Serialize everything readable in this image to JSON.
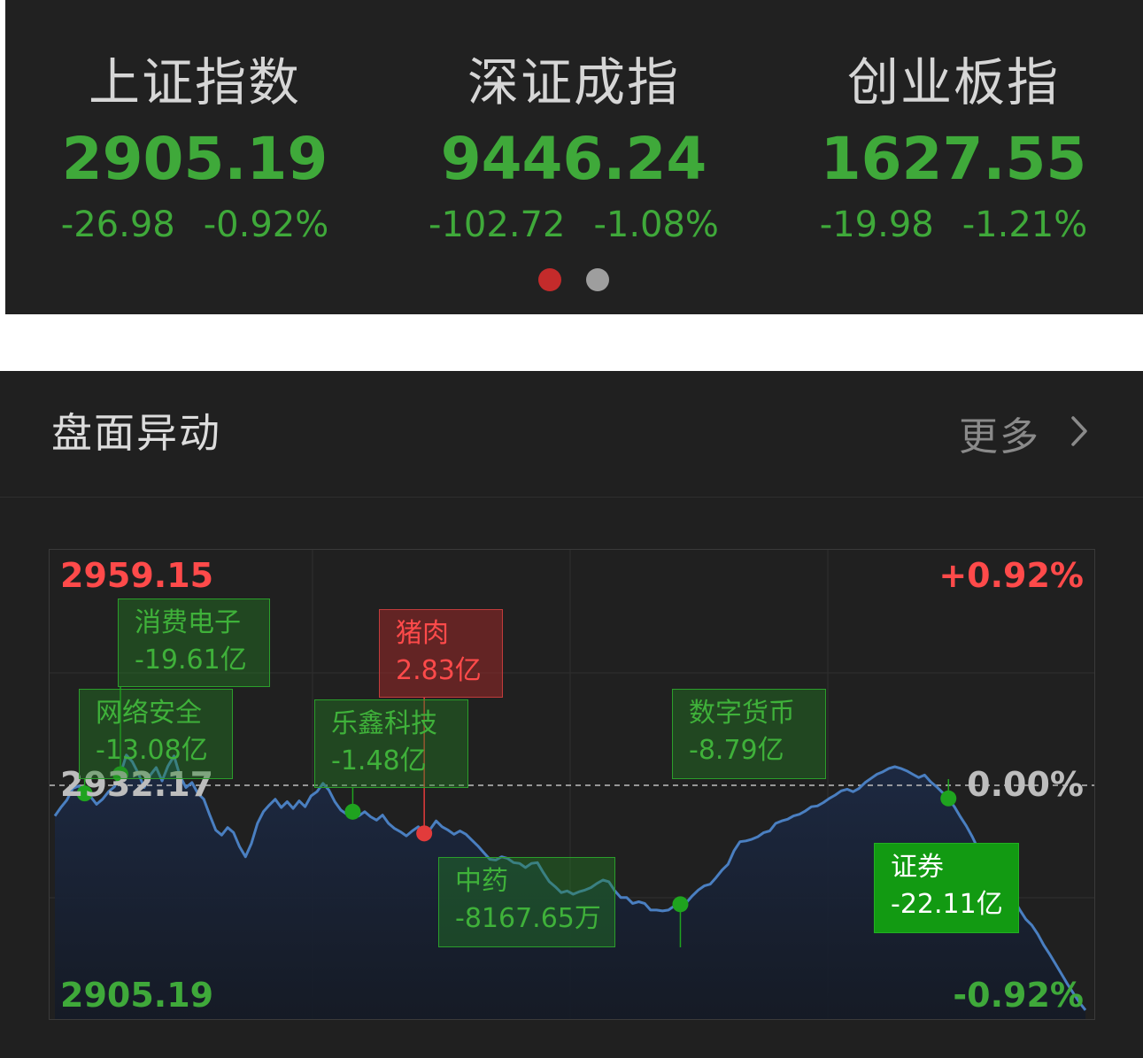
{
  "indices": [
    {
      "name": "上证指数",
      "value": "2905.19",
      "change": "-26.98",
      "change_pct": "-0.92%"
    },
    {
      "name": "深证成指",
      "value": "9446.24",
      "change": "-102.72",
      "change_pct": "-1.08%"
    },
    {
      "name": "创业板指",
      "value": "1627.55",
      "change": "-19.98",
      "change_pct": "-1.21%"
    }
  ],
  "pager": {
    "active_color": "#c42b2b",
    "inactive_color": "#9e9e9e"
  },
  "panel": {
    "title": "盘面异动",
    "more_label": "更多"
  },
  "colors": {
    "up": "#ff4a4a",
    "down": "#3fa93a",
    "line": "#4a7fc1",
    "neutral": "#bdbdbd"
  },
  "chart_data": {
    "type": "line",
    "title": "",
    "y_top_label": "2959.15",
    "y_mid_label": "2932.17",
    "y_bottom_label": "2905.19",
    "pct_top_label": "+0.92%",
    "pct_mid_label": "0.00%",
    "pct_bottom_label": "-0.92%",
    "ylim": [
      2905.19,
      2959.15
    ],
    "xlim": [
      0,
      240
    ],
    "reference": 2932.17,
    "series": [
      {
        "values": [
          2928.5,
          2929.5,
          2930.4,
          2931.8,
          2932.1,
          2931.2,
          2930.8,
          2929.9,
          2930.5,
          2931.4,
          2932.0,
          2933.5,
          2935.8,
          2935.0,
          2933.6,
          2931.9,
          2933.4,
          2934.3,
          2932.7,
          2934.5,
          2935.7,
          2933.3,
          2931.9,
          2932.5,
          2931.2,
          2930.5,
          2928.6,
          2926.8,
          2926.2,
          2927.1,
          2926.5,
          2924.8,
          2923.6,
          2925.2,
          2927.6,
          2929.0,
          2929.8,
          2930.5,
          2929.5,
          2930.2,
          2929.4,
          2930.3,
          2929.6,
          2930.9,
          2931.4,
          2932.4,
          2931.6,
          2930.2,
          2929.2,
          2928.7,
          2929.0,
          2928.5,
          2929.0,
          2928.4,
          2928.0,
          2928.6,
          2927.6,
          2927.0,
          2926.6,
          2926.1,
          2926.7,
          2927.2,
          2926.4,
          2926.9,
          2927.9,
          2927.2,
          2926.8,
          2926.3,
          2926.7,
          2926.3,
          2925.6,
          2924.9,
          2924.1,
          2923.3,
          2923.2,
          2923.6,
          2923.4,
          2922.9,
          2922.8,
          2922.3,
          2922.8,
          2922.9,
          2921.7,
          2920.6,
          2920.0,
          2919.3,
          2919.5,
          2919.1,
          2919.4,
          2919.6,
          2919.9,
          2920.4,
          2920.8,
          2920.6,
          2919.5,
          2918.7,
          2918.7,
          2918.0,
          2918.2,
          2918.0,
          2917.2,
          2917.2,
          2917.1,
          2917.2,
          2917.7,
          2917.9,
          2918.1,
          2918.9,
          2919.6,
          2920.1,
          2920.3,
          2921.1,
          2922.0,
          2922.7,
          2924.3,
          2925.4,
          2925.5,
          2925.7,
          2926.0,
          2926.5,
          2926.7,
          2927.6,
          2927.9,
          2928.1,
          2928.5,
          2928.7,
          2929.1,
          2929.6,
          2929.7,
          2930.1,
          2930.6,
          2931.0,
          2931.5,
          2931.7,
          2931.4,
          2931.8,
          2932.5,
          2933.0,
          2933.5,
          2933.8,
          2934.2,
          2934.4,
          2934.2,
          2933.9,
          2933.5,
          2933.1,
          2933.4,
          2932.6,
          2932.0,
          2931.3,
          2930.6,
          2929.6,
          2928.4,
          2927.3,
          2926.0,
          2924.5,
          2923.2,
          2921.9,
          2920.9,
          2920.3,
          2919.3,
          2918.4,
          2917.2,
          2916.1,
          2915.4,
          2914.3,
          2913.0,
          2911.9,
          2910.7,
          2909.5,
          2908.3,
          2907.2,
          2906.1,
          2905.2
        ]
      }
    ],
    "events": [
      {
        "name": "消费电子",
        "amount": "-19.61亿",
        "direction": "down"
      },
      {
        "name": "网络安全",
        "amount": "-13.08亿",
        "direction": "down"
      },
      {
        "name": "乐鑫科技",
        "amount": "-1.48亿",
        "direction": "down"
      },
      {
        "name": "猪肉",
        "amount": "2.83亿",
        "direction": "up"
      },
      {
        "name": "中药",
        "amount": "-8167.65万",
        "direction": "down"
      },
      {
        "name": "数字货币",
        "amount": "-8.79亿",
        "direction": "down"
      },
      {
        "name": "证券",
        "amount": "-22.11亿",
        "direction": "down"
      }
    ]
  }
}
